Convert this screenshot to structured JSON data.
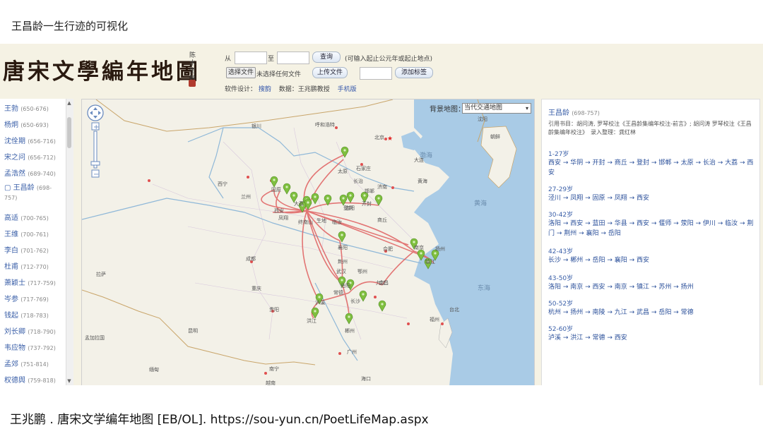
{
  "slide": {
    "title": "王昌龄一生行迹的可视化",
    "caption": "王兆鹏 . 唐宋文学编年地图 [EB/OL].  https://sou-yun.cn/PoetLifeMap.aspx"
  },
  "header": {
    "logo": "唐宋文學編年地圖",
    "seal_text": "陈水生题",
    "from_label": "从",
    "to_label": "至",
    "from_value": "",
    "to_value": "",
    "query_button": "查询",
    "query_hint": "(可输入起止公元年或起止地点)",
    "choose_file_button": "选择文件",
    "no_file_text": "未选择任何文件",
    "upload_button": "上传文件",
    "tag_value": "",
    "add_tag_button": "添加标签",
    "credits_prefix": "软件设计：",
    "credits_designer": "搜韵",
    "credits_data": "数据：王兆鹏教授",
    "credits_mobile": "手机版"
  },
  "poet_list": [
    {
      "name": "王勃",
      "years": "(650-676)"
    },
    {
      "name": "杨炯",
      "years": "(650-693)"
    },
    {
      "name": "沈佺期",
      "years": "(656-716)"
    },
    {
      "name": "宋之问",
      "years": "(656-712)"
    },
    {
      "name": "孟浩然",
      "years": "(689-740)"
    },
    {
      "name": "▢ 王昌龄",
      "years": "(698-757)"
    },
    {
      "name": "高适",
      "years": "(700-765)"
    },
    {
      "name": "王维",
      "years": "(700-761)"
    },
    {
      "name": "李白",
      "years": "(701-762)"
    },
    {
      "name": "杜甫",
      "years": "(712-770)"
    },
    {
      "name": "萧颖士",
      "years": "(717-759)"
    },
    {
      "name": "岑参",
      "years": "(717-769)"
    },
    {
      "name": "钱起",
      "years": "(718-783)"
    },
    {
      "name": "刘长卿",
      "years": "(718-790)"
    },
    {
      "name": "韦应物",
      "years": "(737-792)"
    },
    {
      "name": "孟郊",
      "years": "(751-814)"
    },
    {
      "name": "权德舆",
      "years": "(759-818)"
    }
  ],
  "map": {
    "background_label": "背景地图：",
    "background_select": "当代交通地图",
    "place_labels": [
      "呼和浩特",
      "北京",
      "大连",
      "朝鲜",
      "沈阳",
      "长春",
      "太原",
      "石家庄",
      "济南",
      "黄海",
      "西宁",
      "兰州",
      "银川",
      "固原",
      "凤翔",
      "终南山",
      "生地",
      "临汝",
      "洛阳",
      "开封",
      "商丘",
      "合肥",
      "南京",
      "镇江",
      "扬州",
      "武汉",
      "岳阳",
      "长沙",
      "南昌",
      "成都",
      "重庆",
      "贵阳",
      "广州",
      "南宁",
      "昆明",
      "拉萨",
      "福州",
      "台北",
      "海口",
      "郴州",
      "常德",
      "洪江",
      "泸溪",
      "九江",
      "荆州",
      "襄阳",
      "鄂州",
      "邯郸",
      "登封",
      "长治",
      "大荔",
      "西安"
    ],
    "water_labels": [
      "渤海",
      "黄海",
      "东海"
    ],
    "region_labels": [
      "孟加拉国",
      "缅甸",
      "越南"
    ]
  },
  "panel": {
    "poet_name": "王昌龄",
    "poet_years": "(698-757)",
    "reference": "引用书目：胡问涛, 罗琴校注《王昌龄集编年校注-前言》; 胡问涛 罗琴校注《王昌龄集编年校注》　录入整理：龚红林",
    "periods": [
      {
        "age": "1-27岁",
        "route": "西安 → 华阴 → 开封 → 商丘 → 登封 → 邯郸 → 太原 → 长治 → 大荔 → 西安"
      },
      {
        "age": "27-29岁",
        "route": "泾川 → 凤翔 → 固原 → 凤翔 → 西安"
      },
      {
        "age": "30-42岁",
        "route": "洛阳 → 西安 → 蓝田 → 华县 → 西安 → 偃师 → 荥阳 → 伊川 → 临汝 → 荆门 → 荆州 → 襄阳 → 岳阳"
      },
      {
        "age": "42-43岁",
        "route": "长沙 → 郴州 → 岳阳 → 襄阳 → 西安"
      },
      {
        "age": "43-50岁",
        "route": "洛阳 → 南京 → 西安 → 南京 → 镇江 → 苏州 → 扬州"
      },
      {
        "age": "50-52岁",
        "route": "杭州 → 扬州 → 南陵 → 九江 → 武昌 → 岳阳 → 常德"
      },
      {
        "age": "52-60岁",
        "route": "泸溪 → 洪江 → 常德 → 西安"
      }
    ]
  },
  "colors": {
    "sea": "#a9cbe6",
    "land": "#f3f1e8",
    "route": "#e06060",
    "marker": "#7fbf3f",
    "link": "#3a5fa8"
  }
}
